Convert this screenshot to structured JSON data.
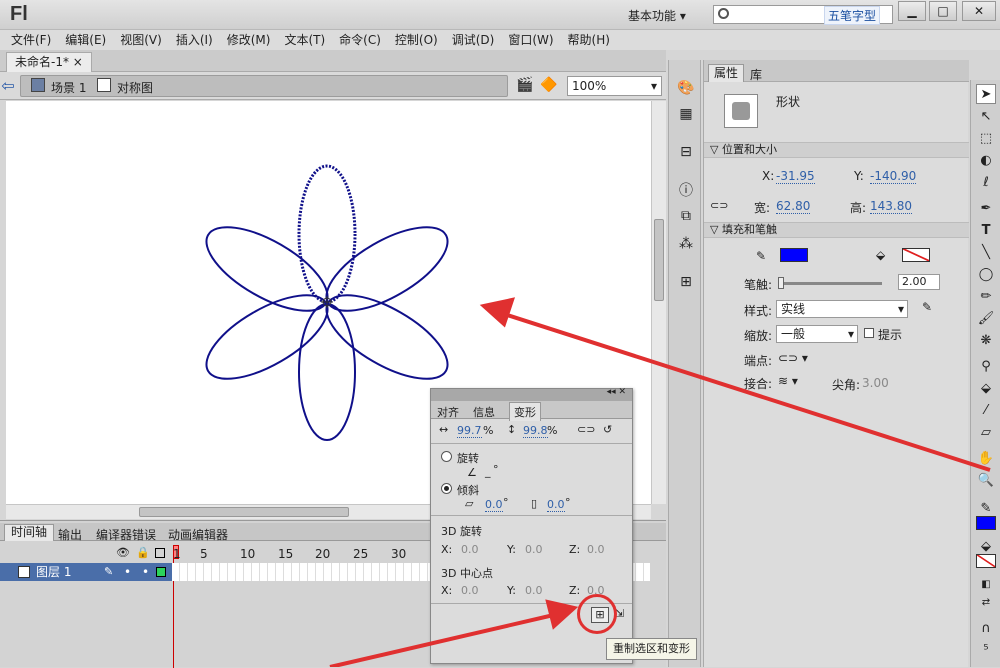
{
  "app": {
    "logo": "Fl",
    "workspace": "基本功能",
    "ime": "五笔字型"
  },
  "window_controls": {
    "min": "▁",
    "max": "□",
    "close": "✕"
  },
  "menu": [
    "文件(F)",
    "编辑(E)",
    "视图(V)",
    "插入(I)",
    "修改(M)",
    "文本(T)",
    "命令(C)",
    "控制(O)",
    "调试(D)",
    "窗口(W)",
    "帮助(H)"
  ],
  "doc": {
    "tab": "未命名-1*",
    "close": "×",
    "scene": "场景 1",
    "symbol": "对称图",
    "zoom": "100%"
  },
  "timeline": {
    "tabs": [
      "时间轴",
      "输出",
      "编译器错误",
      "动画编辑器"
    ],
    "frames": [
      "1",
      "5",
      "10",
      "15",
      "20",
      "25",
      "30"
    ],
    "layer": "图层 1"
  },
  "props": {
    "tabs": [
      "属性",
      "库"
    ],
    "shape_label": "形状",
    "pos_section": "位置和大小",
    "x_label": "X:",
    "x": "-31.95",
    "y_label": "Y:",
    "y": "-140.90",
    "w_label": "宽:",
    "w": "62.80",
    "h_label": "高:",
    "h": "143.80",
    "fill_section": "填充和笔触",
    "stroke_label": "笔触:",
    "stroke": "2.00",
    "style_label": "样式:",
    "style": "实线",
    "scale_label": "缩放:",
    "scale": "一般",
    "hint": "提示",
    "cap_label": "端点:",
    "join_label": "接合:",
    "miter_label": "尖角:",
    "miter": "3.00",
    "stroke_color": "#0000ff"
  },
  "transform": {
    "tabs": [
      "对齐",
      "信息",
      "变形"
    ],
    "w_scale": "99.7",
    "h_scale": "99.8",
    "pct": "%",
    "rotate": "旋转",
    "rotate_val": "_",
    "deg": "°",
    "skew": "倾斜",
    "skew_h": "0.0",
    "skew_v": "0.0",
    "rot3d": "3D 旋转",
    "c3d": "3D 中心点",
    "x": "X:",
    "y": "Y:",
    "z": "Z:",
    "r3x": "0.0",
    "r3y": "0.0",
    "r3z": "0.0",
    "c3x": "0.0",
    "c3y": "0.0",
    "c3z": "0.0",
    "tooltip": "重制选区和变形"
  }
}
